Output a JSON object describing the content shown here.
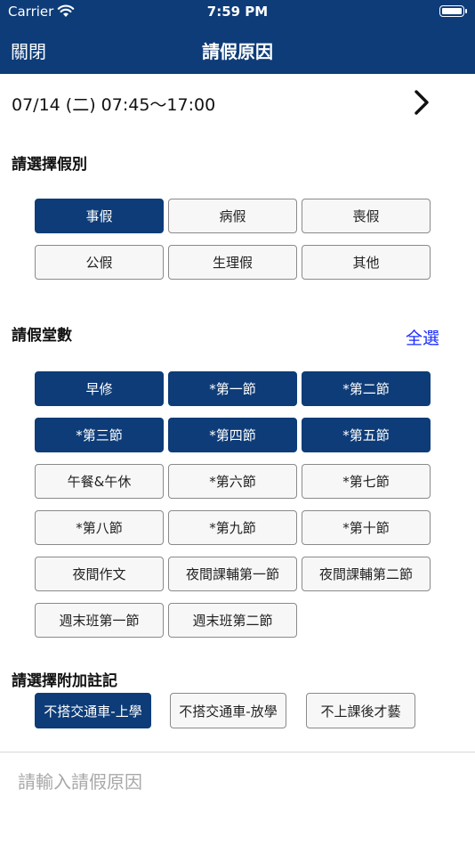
{
  "status_bar": {
    "carrier": "Carrier",
    "time": "7:59 PM"
  },
  "nav": {
    "close": "關閉",
    "title": "請假原因"
  },
  "date": {
    "text": "07/14 (二) 07:45～17:00"
  },
  "leave_type": {
    "title": "請選擇假別",
    "options": [
      {
        "label": "事假",
        "selected": true
      },
      {
        "label": "病假",
        "selected": false
      },
      {
        "label": "喪假",
        "selected": false
      },
      {
        "label": "公假",
        "selected": false
      },
      {
        "label": "生理假",
        "selected": false
      },
      {
        "label": "其他",
        "selected": false
      }
    ]
  },
  "periods": {
    "title": "請假堂數",
    "select_all": "全選",
    "options": [
      {
        "label": "早修",
        "selected": true
      },
      {
        "label": "*第一節",
        "selected": true
      },
      {
        "label": "*第二節",
        "selected": true
      },
      {
        "label": "*第三節",
        "selected": true
      },
      {
        "label": "*第四節",
        "selected": true
      },
      {
        "label": "*第五節",
        "selected": true
      },
      {
        "label": "午餐&午休",
        "selected": false
      },
      {
        "label": "*第六節",
        "selected": false
      },
      {
        "label": "*第七節",
        "selected": false
      },
      {
        "label": "*第八節",
        "selected": false
      },
      {
        "label": "*第九節",
        "selected": false
      },
      {
        "label": "*第十節",
        "selected": false
      },
      {
        "label": "夜間作文",
        "selected": false
      },
      {
        "label": "夜間課輔第一節",
        "selected": false
      },
      {
        "label": "夜間課輔第二節",
        "selected": false
      },
      {
        "label": "週末班第一節",
        "selected": false
      },
      {
        "label": "週末班第二節",
        "selected": false
      }
    ]
  },
  "notes": {
    "title": "請選擇附加註記",
    "options": [
      {
        "label": "不搭交通車-上學",
        "selected": true
      },
      {
        "label": "不搭交通車-放學",
        "selected": false
      },
      {
        "label": "不上課後才藝",
        "selected": false
      }
    ]
  },
  "reason": {
    "placeholder": "請輸入請假原因",
    "value": ""
  },
  "colors": {
    "primary": "#0d3c78",
    "link": "#1a2cff"
  },
  "icons": {
    "wifi": "wifi-icon",
    "battery": "battery-icon",
    "next": "chevron-right-icon"
  }
}
